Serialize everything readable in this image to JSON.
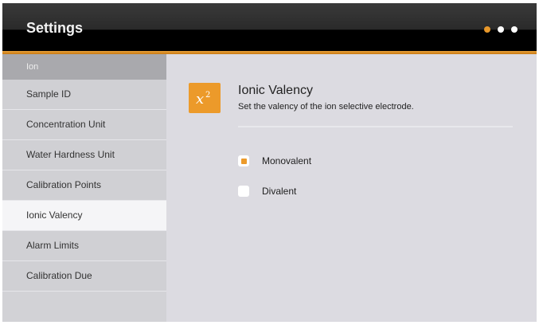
{
  "header": {
    "title": "Settings",
    "page_dots": [
      true,
      false,
      false
    ]
  },
  "sidebar": {
    "section_label": "Ion",
    "items": [
      {
        "label": "Sample ID",
        "selected": false
      },
      {
        "label": "Concentration Unit",
        "selected": false
      },
      {
        "label": "Water Hardness Unit",
        "selected": false
      },
      {
        "label": "Calibration Points",
        "selected": false
      },
      {
        "label": "Ionic Valency",
        "selected": true
      },
      {
        "label": "Alarm Limits",
        "selected": false
      },
      {
        "label": "Calibration Due",
        "selected": false
      }
    ]
  },
  "main": {
    "icon": "x-squared-icon",
    "title": "Ionic Valency",
    "description": "Set the valency of the ion selective electrode.",
    "options": [
      {
        "label": "Monovalent",
        "selected": true
      },
      {
        "label": "Divalent",
        "selected": false
      }
    ]
  },
  "colors": {
    "accent": "#ec9a2a",
    "header_bg": "#1a1a1a",
    "content_bg": "#dcdbe1"
  }
}
